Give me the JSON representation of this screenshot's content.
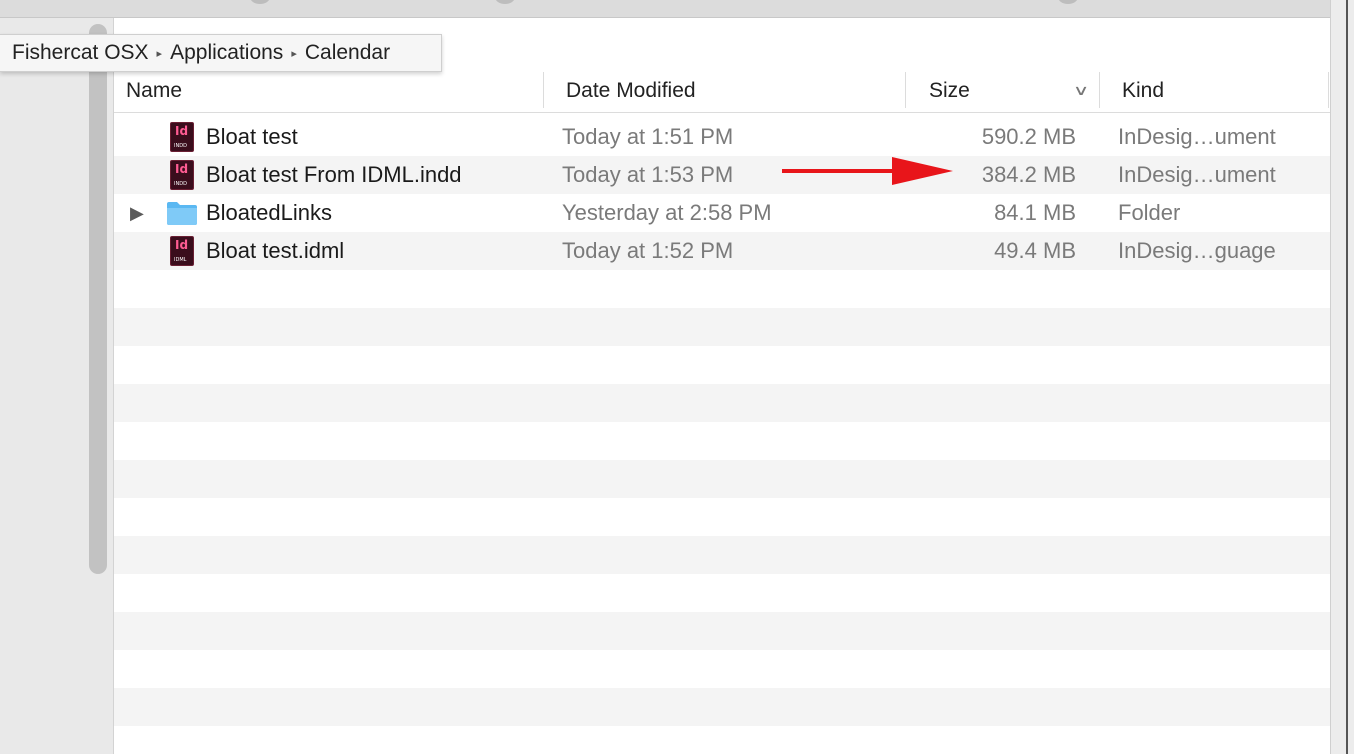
{
  "breadcrumb": {
    "items": [
      "Fishercat OSX",
      "Applications",
      "Calendar"
    ]
  },
  "columns": {
    "name": "Name",
    "date_modified": "Date Modified",
    "size": "Size",
    "kind": "Kind"
  },
  "files": [
    {
      "name": "Bloat test",
      "date": "Today at 1:51 PM",
      "size": "590.2 MB",
      "kind": "InDesig…ument",
      "icon": "indesign-document-icon",
      "icon_label": "Id",
      "icon_sub": "INDD"
    },
    {
      "name": "Bloat test From IDML.indd",
      "date": "Today at 1:53 PM",
      "size": "384.2 MB",
      "kind": "InDesig…ument",
      "icon": "indesign-document-icon",
      "icon_label": "Id",
      "icon_sub": "INDD"
    },
    {
      "name": "BloatedLinks",
      "date": "Yesterday at 2:58 PM",
      "size": "84.1 MB",
      "kind": "Folder",
      "icon": "folder-icon"
    },
    {
      "name": "Bloat test.idml",
      "date": "Today at 1:52 PM",
      "size": "49.4 MB",
      "kind": "InDesig…guage",
      "icon": "indesign-markup-icon",
      "icon_label": "Id",
      "icon_sub": "IDML"
    }
  ],
  "colors": {
    "annotation_arrow": "#e8151a",
    "folder": "#5ab8f2",
    "indesign": "#3a0d1c",
    "indesign_accent": "#ff5c93"
  }
}
